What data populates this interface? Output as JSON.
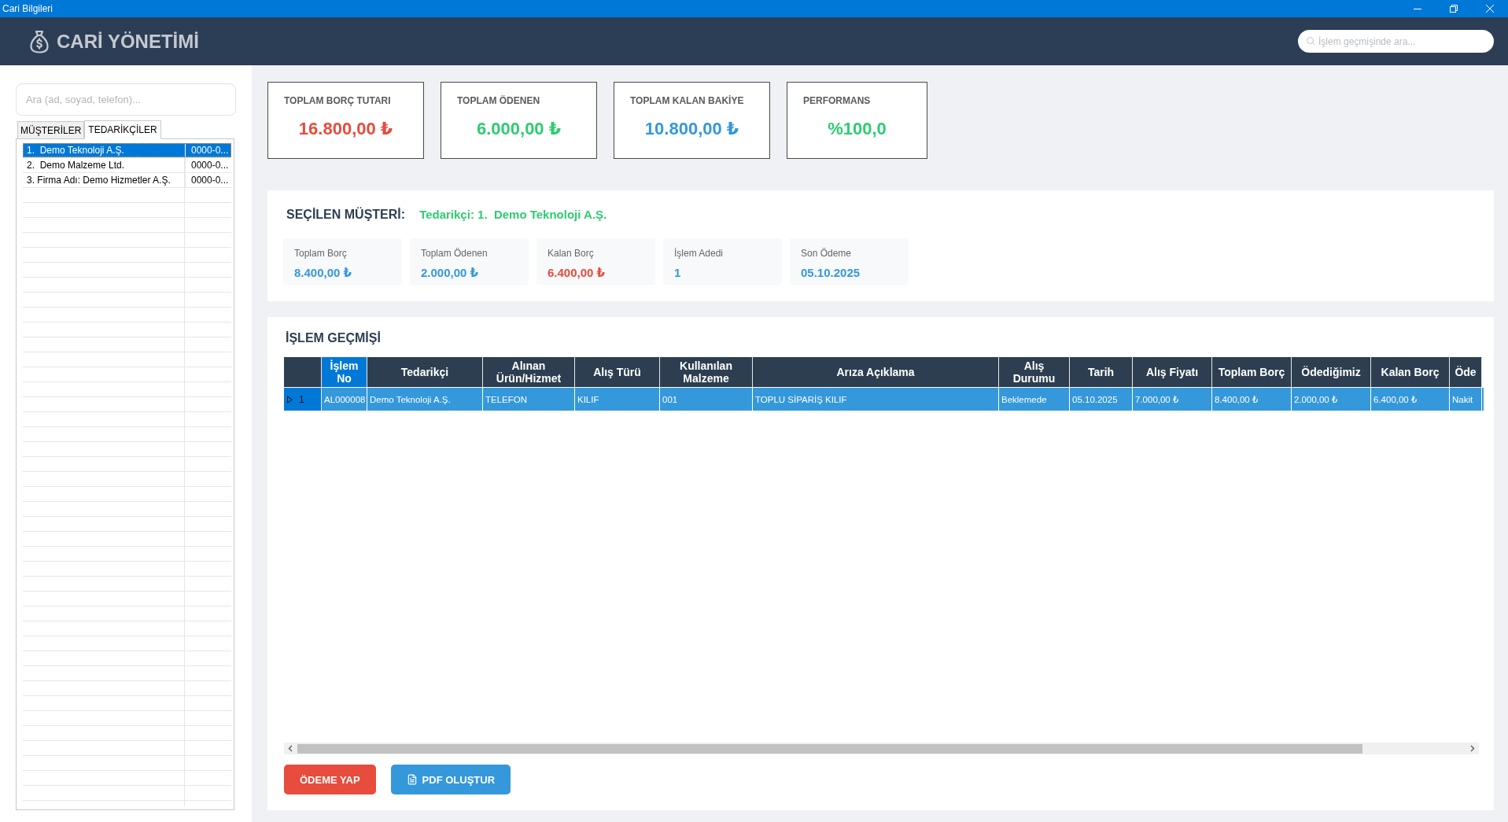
{
  "window": {
    "title": "Cari Bilgileri"
  },
  "header": {
    "title": "CARİ YÖNETİMİ",
    "search": {
      "placeholder": "İşlem geçmişinde ara..."
    }
  },
  "sidebar": {
    "search": {
      "placeholder": "Ara (ad, soyad, telefon)..."
    },
    "tabs": [
      {
        "label": "MÜŞTERİLER",
        "selected": false
      },
      {
        "label": "TEDARİKÇİLER",
        "selected": true
      }
    ],
    "list": [
      {
        "cells": [
          "1.  Demo Teknoloji A.Ş.",
          "0000-0..."
        ],
        "selected": true
      },
      {
        "cells": [
          "2.  Demo Malzeme Ltd.",
          "0000-0..."
        ],
        "selected": false
      },
      {
        "cells": [
          "3. Firma Adı: Demo Hizmetler A.Ş.",
          "0000-0..."
        ],
        "selected": false
      }
    ]
  },
  "summary_cards": [
    {
      "label": "TOPLAM BORÇ TUTARI",
      "value": "16.800,00 ₺",
      "color": "#e74c3c"
    },
    {
      "label": "TOPLAM ÖDENEN",
      "value": "6.000,00 ₺",
      "color": "#2ecc71"
    },
    {
      "label": "TOPLAM KALAN BAKİYE",
      "value": "10.800,00 ₺",
      "color": "#3498db"
    },
    {
      "label": "PERFORMANS",
      "value": "%100,0",
      "color": "#2ecc71"
    }
  ],
  "selected_customer": {
    "title": "SEÇİLEN MÜŞTERİ:",
    "name": "Tedarikçi: 1.  Demo Teknoloji A.Ş.",
    "stats": [
      {
        "label": "Toplam Borç",
        "value": "8.400,00 ₺",
        "color": "#3498db"
      },
      {
        "label": "Toplam Ödenen",
        "value": "2.000,00 ₺",
        "color": "#3498db"
      },
      {
        "label": "Kalan Borç",
        "value": "6.400,00 ₺",
        "color": "#e74c3c"
      },
      {
        "label": "İşlem Adedi",
        "value": "1",
        "color": "#3498db"
      },
      {
        "label": "Son Ödeme",
        "value": "05.10.2025",
        "color": "#3498db"
      }
    ]
  },
  "history": {
    "title": "İŞLEM GEÇMİŞİ",
    "table": {
      "columns": [
        {
          "label": "İşlem No",
          "selected": true
        },
        {
          "label": "Tedarikçi",
          "selected": false
        },
        {
          "label": "Alınan Ürün/Hizmet",
          "selected": false
        },
        {
          "label": "Alış Türü",
          "selected": false
        },
        {
          "label": "Kullanılan Malzeme",
          "selected": false
        },
        {
          "label": "Arıza Açıklama",
          "selected": false
        },
        {
          "label": "Alış Durumu",
          "selected": false
        },
        {
          "label": "Tarih",
          "selected": false
        },
        {
          "label": "Alış Fiyatı",
          "selected": false
        },
        {
          "label": "Toplam Borç",
          "selected": false
        },
        {
          "label": "Ödediğimiz",
          "selected": false
        },
        {
          "label": "Kalan Borç",
          "selected": false
        },
        {
          "label": "Öde",
          "selected": false
        }
      ],
      "rows": [
        {
          "row_number": "1",
          "current": true,
          "selected": true,
          "cells": [
            "AL000008",
            "Demo Teknoloji A.Ş.",
            "TELEFON",
            "KILIF",
            "001",
            "TOPLU SİPARİŞ KILIF",
            "Beklemede",
            "05.10.2025",
            "7.000,00 ₺",
            "8.400,00 ₺",
            "2.000,00 ₺",
            "6.400,00 ₺",
            "Nakit"
          ]
        }
      ]
    },
    "buttons": [
      {
        "label": "ÖDEME YAP",
        "kind": "text",
        "color": "#e74c3c"
      },
      {
        "label": "PDF OLUŞTUR",
        "kind": "document",
        "color": "#3498db"
      }
    ]
  }
}
